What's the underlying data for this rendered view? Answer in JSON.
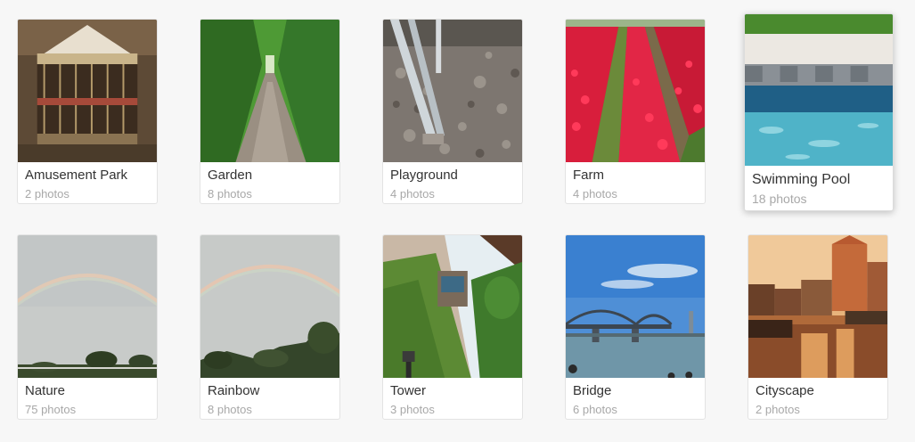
{
  "albums": [
    {
      "title": "Amusement Park",
      "count": "2 photos",
      "image": "carousel"
    },
    {
      "title": "Garden",
      "count": "8 photos",
      "image": "hedge-tunnel"
    },
    {
      "title": "Playground",
      "count": "4 photos",
      "image": "gravel-posts"
    },
    {
      "title": "Farm",
      "count": "4 photos",
      "image": "tulip-field"
    },
    {
      "title": "Swimming Pool",
      "count": "18 photos",
      "image": "pool-edge"
    },
    {
      "title": "Nature",
      "count": "75 photos",
      "image": "rainbow-sky"
    },
    {
      "title": "Rainbow",
      "count": "8 photos",
      "image": "rainbow-trees"
    },
    {
      "title": "Tower",
      "count": "3 photos",
      "image": "ivy-tower"
    },
    {
      "title": "Bridge",
      "count": "6 photos",
      "image": "arch-bridge"
    },
    {
      "title": "Cityscape",
      "count": "2 photos",
      "image": "canal-sunset"
    }
  ],
  "colors": {
    "background": "#f7f7f7",
    "card": "#ffffff",
    "title_text": "#333333",
    "count_text": "#a8a8a8"
  }
}
